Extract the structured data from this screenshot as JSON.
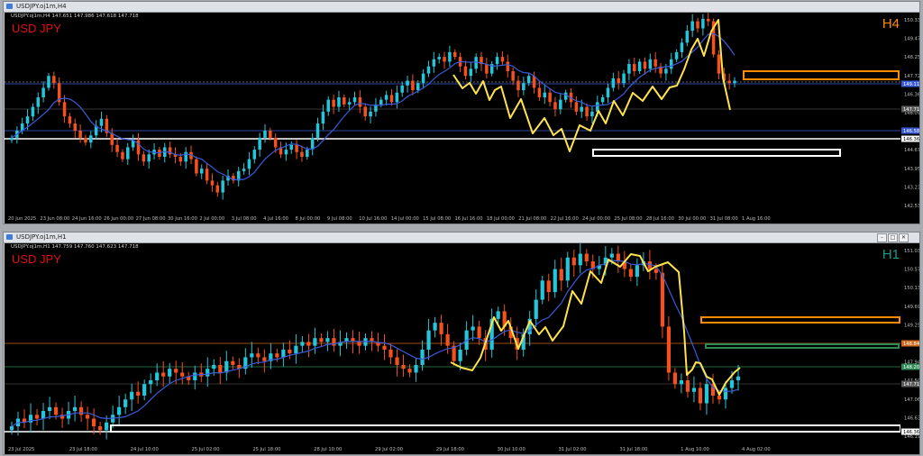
{
  "charts": [
    {
      "window_title": "USDJPY.oj1m,H4",
      "info_line": "USDJPY.oj1m,H4  147.651 147.986 147.618 147.718",
      "symbol_label": "USD JPY",
      "timeframe": "H4",
      "timeframe_color": "#ff8c00",
      "price_labels": [
        "150.335",
        "149.470",
        "148.250",
        "147.720",
        "146.363",
        "146.090",
        "145.350",
        "144.670",
        "143.950",
        "143.230",
        "142.530"
      ],
      "time_labels": [
        "20 Jun 2025",
        "23 Jun 08:00",
        "24 Jun 16:00",
        "26 Jun 00:00",
        "27 Jun 08:00",
        "30 Jun 16:00",
        "2 Jul 00:00",
        "3 Jul 08:00",
        "4 Jul 16:00",
        "8 Jul 00:00",
        "9 Jul 08:00",
        "10 Jul 16:00",
        "14 Jul 00:00",
        "15 Jul 08:00",
        "16 Jul 16:00",
        "18 Jul 00:00",
        "21 Jul 08:00",
        "22 Jul 16:00",
        "24 Jul 00:00",
        "25 Jul 08:00",
        "28 Jul 16:00",
        "30 Jul 00:00",
        "31 Jul 08:00",
        "1 Aug 16:00"
      ],
      "level_tags": [
        {
          "text": "149.113",
          "color": "#3a5bd9"
        },
        {
          "text": "147.718",
          "color": "#5a5a5a"
        },
        {
          "text": "146.580",
          "color": "#3a5bd9"
        },
        {
          "text": "146.363",
          "color": "#ffffff"
        }
      ]
    },
    {
      "window_title": "USDJPY.oj1m,H1",
      "info_line": "USDJPY.oj1m,H1  147.759 147.760 147.623 147.718",
      "symbol_label": "USD JPY",
      "timeframe": "H1",
      "timeframe_color": "#1a9a8a",
      "price_labels": [
        "151.030",
        "150.570",
        "150.130",
        "149.690",
        "149.250",
        "148.360",
        "147.940",
        "147.500",
        "147.060",
        "146.630",
        "146.190"
      ],
      "time_labels": [
        "23 Jul 2025",
        "23 Jul 18:00",
        "24 Jul 10:00",
        "25 Jul 02:00",
        "25 Jul 18:00",
        "28 Jul 10:00",
        "29 Jul 02:00",
        "29 Jul 18:00",
        "30 Jul 10:00",
        "31 Jul 02:00",
        "31 Jul 18:00",
        "1 Aug 10:00",
        "4 Aug 02:00"
      ],
      "level_tags": [
        {
          "text": "148.845",
          "color": "#d2691e"
        },
        {
          "text": "148.208",
          "color": "#2e8b57"
        },
        {
          "text": "147.718",
          "color": "#5a5a5a"
        },
        {
          "text": "146.363",
          "color": "#ffffff"
        }
      ]
    }
  ],
  "chart_data": [
    {
      "type": "candlestick",
      "title": "USD JPY H4",
      "x_range": [
        "20 Jun 2025",
        "1 Aug 2025"
      ],
      "ylim": [
        142.53,
        150.335
      ],
      "close_series": [
        145.3,
        145.6,
        145.9,
        146.2,
        146.6,
        147.0,
        147.4,
        147.9,
        147.6,
        146.8,
        146.2,
        145.9,
        145.6,
        145.3,
        145.1,
        145.4,
        145.8,
        146.1,
        145.5,
        145.0,
        144.7,
        144.4,
        144.9,
        145.2,
        144.6,
        144.3,
        144.6,
        144.8,
        144.5,
        144.9,
        144.6,
        144.5,
        144.3,
        144.7,
        144.4,
        143.8,
        144.0,
        143.5,
        143.3,
        143.0,
        143.5,
        143.7,
        143.5,
        143.9,
        144.0,
        144.4,
        144.8,
        145.3,
        145.6,
        145.3,
        144.9,
        144.6,
        144.8,
        145.0,
        144.7,
        144.5,
        144.8,
        145.3,
        145.9,
        146.4,
        146.9,
        146.6,
        147.0,
        146.7,
        146.8,
        147.0,
        146.6,
        146.2,
        146.4,
        146.7,
        146.9,
        147.1,
        146.8,
        147.2,
        147.5,
        147.7,
        147.3,
        147.6,
        148.0,
        148.3,
        148.6,
        148.7,
        148.5,
        148.9,
        148.7,
        148.3,
        147.9,
        148.2,
        148.7,
        148.4,
        148.0,
        148.4,
        148.7,
        148.5,
        148.1,
        147.7,
        147.3,
        147.6,
        147.9,
        147.4,
        147.0,
        147.2,
        146.8,
        146.5,
        146.9,
        147.2,
        146.8,
        146.4,
        146.6,
        146.2,
        146.4,
        146.8,
        147.0,
        147.4,
        147.8,
        147.6,
        148.0,
        148.4,
        148.1,
        148.5,
        148.2,
        148.6,
        148.3,
        148.0,
        148.2,
        148.6,
        148.9,
        149.3,
        149.8,
        150.2,
        149.9,
        150.3,
        150.2,
        148.8,
        148.0,
        147.7,
        147.6,
        147.7
      ]
    },
    {
      "type": "candlestick",
      "title": "USD JPY H1",
      "x_range": [
        "23 Jul 2025",
        "4 Aug 2025"
      ],
      "ylim": [
        146.19,
        151.03
      ],
      "close_series": [
        146.4,
        146.6,
        146.5,
        146.7,
        146.6,
        146.8,
        146.9,
        146.7,
        146.6,
        146.8,
        146.9,
        146.7,
        146.6,
        146.4,
        146.3,
        146.5,
        146.7,
        146.9,
        147.1,
        147.3,
        147.2,
        147.5,
        147.6,
        147.8,
        147.7,
        147.9,
        147.8,
        147.7,
        147.6,
        147.8,
        147.7,
        147.9,
        148.0,
        147.8,
        148.1,
        148.0,
        147.9,
        148.2,
        148.3,
        148.2,
        148.1,
        148.3,
        148.2,
        148.4,
        148.3,
        148.5,
        148.6,
        148.5,
        148.7,
        148.6,
        148.7,
        148.5,
        148.6,
        148.7,
        148.6,
        148.5,
        148.7,
        148.6,
        148.5,
        148.4,
        148.2,
        148.0,
        147.9,
        147.8,
        148.0,
        148.4,
        148.9,
        149.1,
        148.8,
        148.5,
        148.1,
        148.4,
        148.9,
        149.0,
        148.7,
        148.4,
        149.2,
        149.4,
        149.0,
        148.7,
        148.4,
        148.8,
        149.2,
        149.7,
        150.2,
        149.9,
        150.5,
        150.2,
        150.8,
        150.6,
        150.9,
        150.7,
        150.5,
        150.6,
        150.8,
        150.9,
        150.7,
        150.5,
        150.3,
        150.6,
        150.7,
        150.5,
        150.4,
        149.0,
        147.8,
        147.5,
        147.6,
        147.3,
        147.4,
        147.0,
        147.5,
        147.2,
        147.1,
        147.4,
        147.6,
        147.7
      ]
    }
  ]
}
